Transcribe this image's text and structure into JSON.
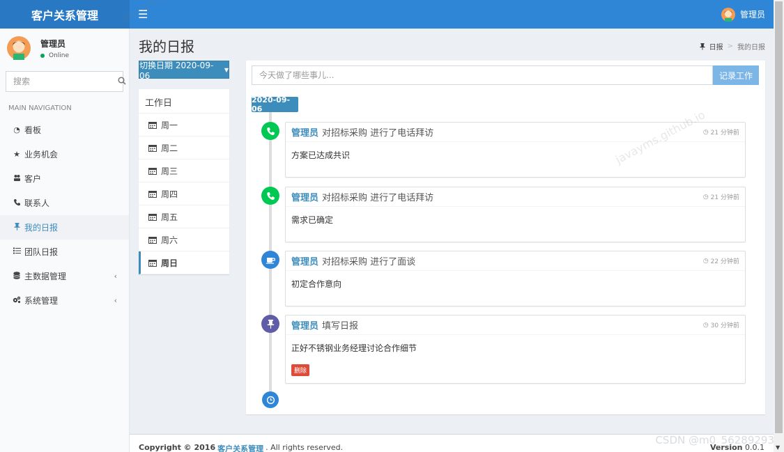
{
  "app": {
    "title": "客户关系管理",
    "menu_icon": "hamburger-icon",
    "user": {
      "name": "管理员",
      "status": "Online"
    }
  },
  "sidebar": {
    "search_placeholder": "搜索",
    "section_header": "MAIN NAVIGATION",
    "items": [
      {
        "label": "看板",
        "icon": "dashboard-icon"
      },
      {
        "label": "业务机会",
        "icon": "star-icon"
      },
      {
        "label": "客户",
        "icon": "users-icon"
      },
      {
        "label": "联系人",
        "icon": "phone-icon"
      },
      {
        "label": "我的日报",
        "icon": "pin-icon",
        "active": true
      },
      {
        "label": "团队日报",
        "icon": "list-icon"
      },
      {
        "label": "主数据管理",
        "icon": "database-icon",
        "has_submenu": true
      },
      {
        "label": "系统管理",
        "icon": "cogs-icon",
        "has_submenu": true
      }
    ],
    "submenu_caret": "‹"
  },
  "page": {
    "title": "我的日报",
    "breadcrumb": {
      "home": "日报",
      "separator": ">",
      "current": "我的日报"
    },
    "switch_date_button": "切换日期 2020-09-06",
    "workday_header": "工作日",
    "weekdays": [
      "周一",
      "周二",
      "周三",
      "周四",
      "周五",
      "周六",
      "周日"
    ],
    "active_weekday": "周日"
  },
  "timeline": {
    "input_placeholder": "今天做了哪些事儿...",
    "submit_button": "记录工作",
    "date_label": "2020-09-06",
    "entries": [
      {
        "who": "管理员",
        "action": "对招标采购 进行了电话拜访",
        "time": "21 分钟前",
        "body": "方案已达成共识",
        "icon": "phone-icon",
        "color": "#00c853"
      },
      {
        "who": "管理员",
        "action": "对招标采购 进行了电话拜访",
        "time": "21 分钟前",
        "body": "需求已确定",
        "icon": "phone-icon",
        "color": "#00c853"
      },
      {
        "who": "管理员",
        "action": "对招标采购 进行了面谈",
        "time": "22 分钟前",
        "body": "初定合作意向",
        "icon": "coffee-icon",
        "color": "#2f86d6"
      },
      {
        "who": "管理员",
        "action": "填写日报",
        "time": "30 分钟前",
        "body": "正好不锈钢业务经理讨论合作细节",
        "icon": "pin-icon",
        "color": "#605ca8",
        "delete_label": "删除"
      }
    ],
    "end_icon": "clock-icon"
  },
  "footer": {
    "copyright": "Copyright © 2016",
    "brand": "客户关系管理",
    "rights": ". All rights reserved.",
    "version_label": "Version",
    "version": "0.0.1"
  },
  "watermark": {
    "text": "javayms.github.io",
    "csdn": "CSDN @m0_56289293"
  },
  "colors": {
    "topbar": "#2f86d6",
    "accent": "#3c8dbc",
    "danger": "#dd4b39"
  }
}
